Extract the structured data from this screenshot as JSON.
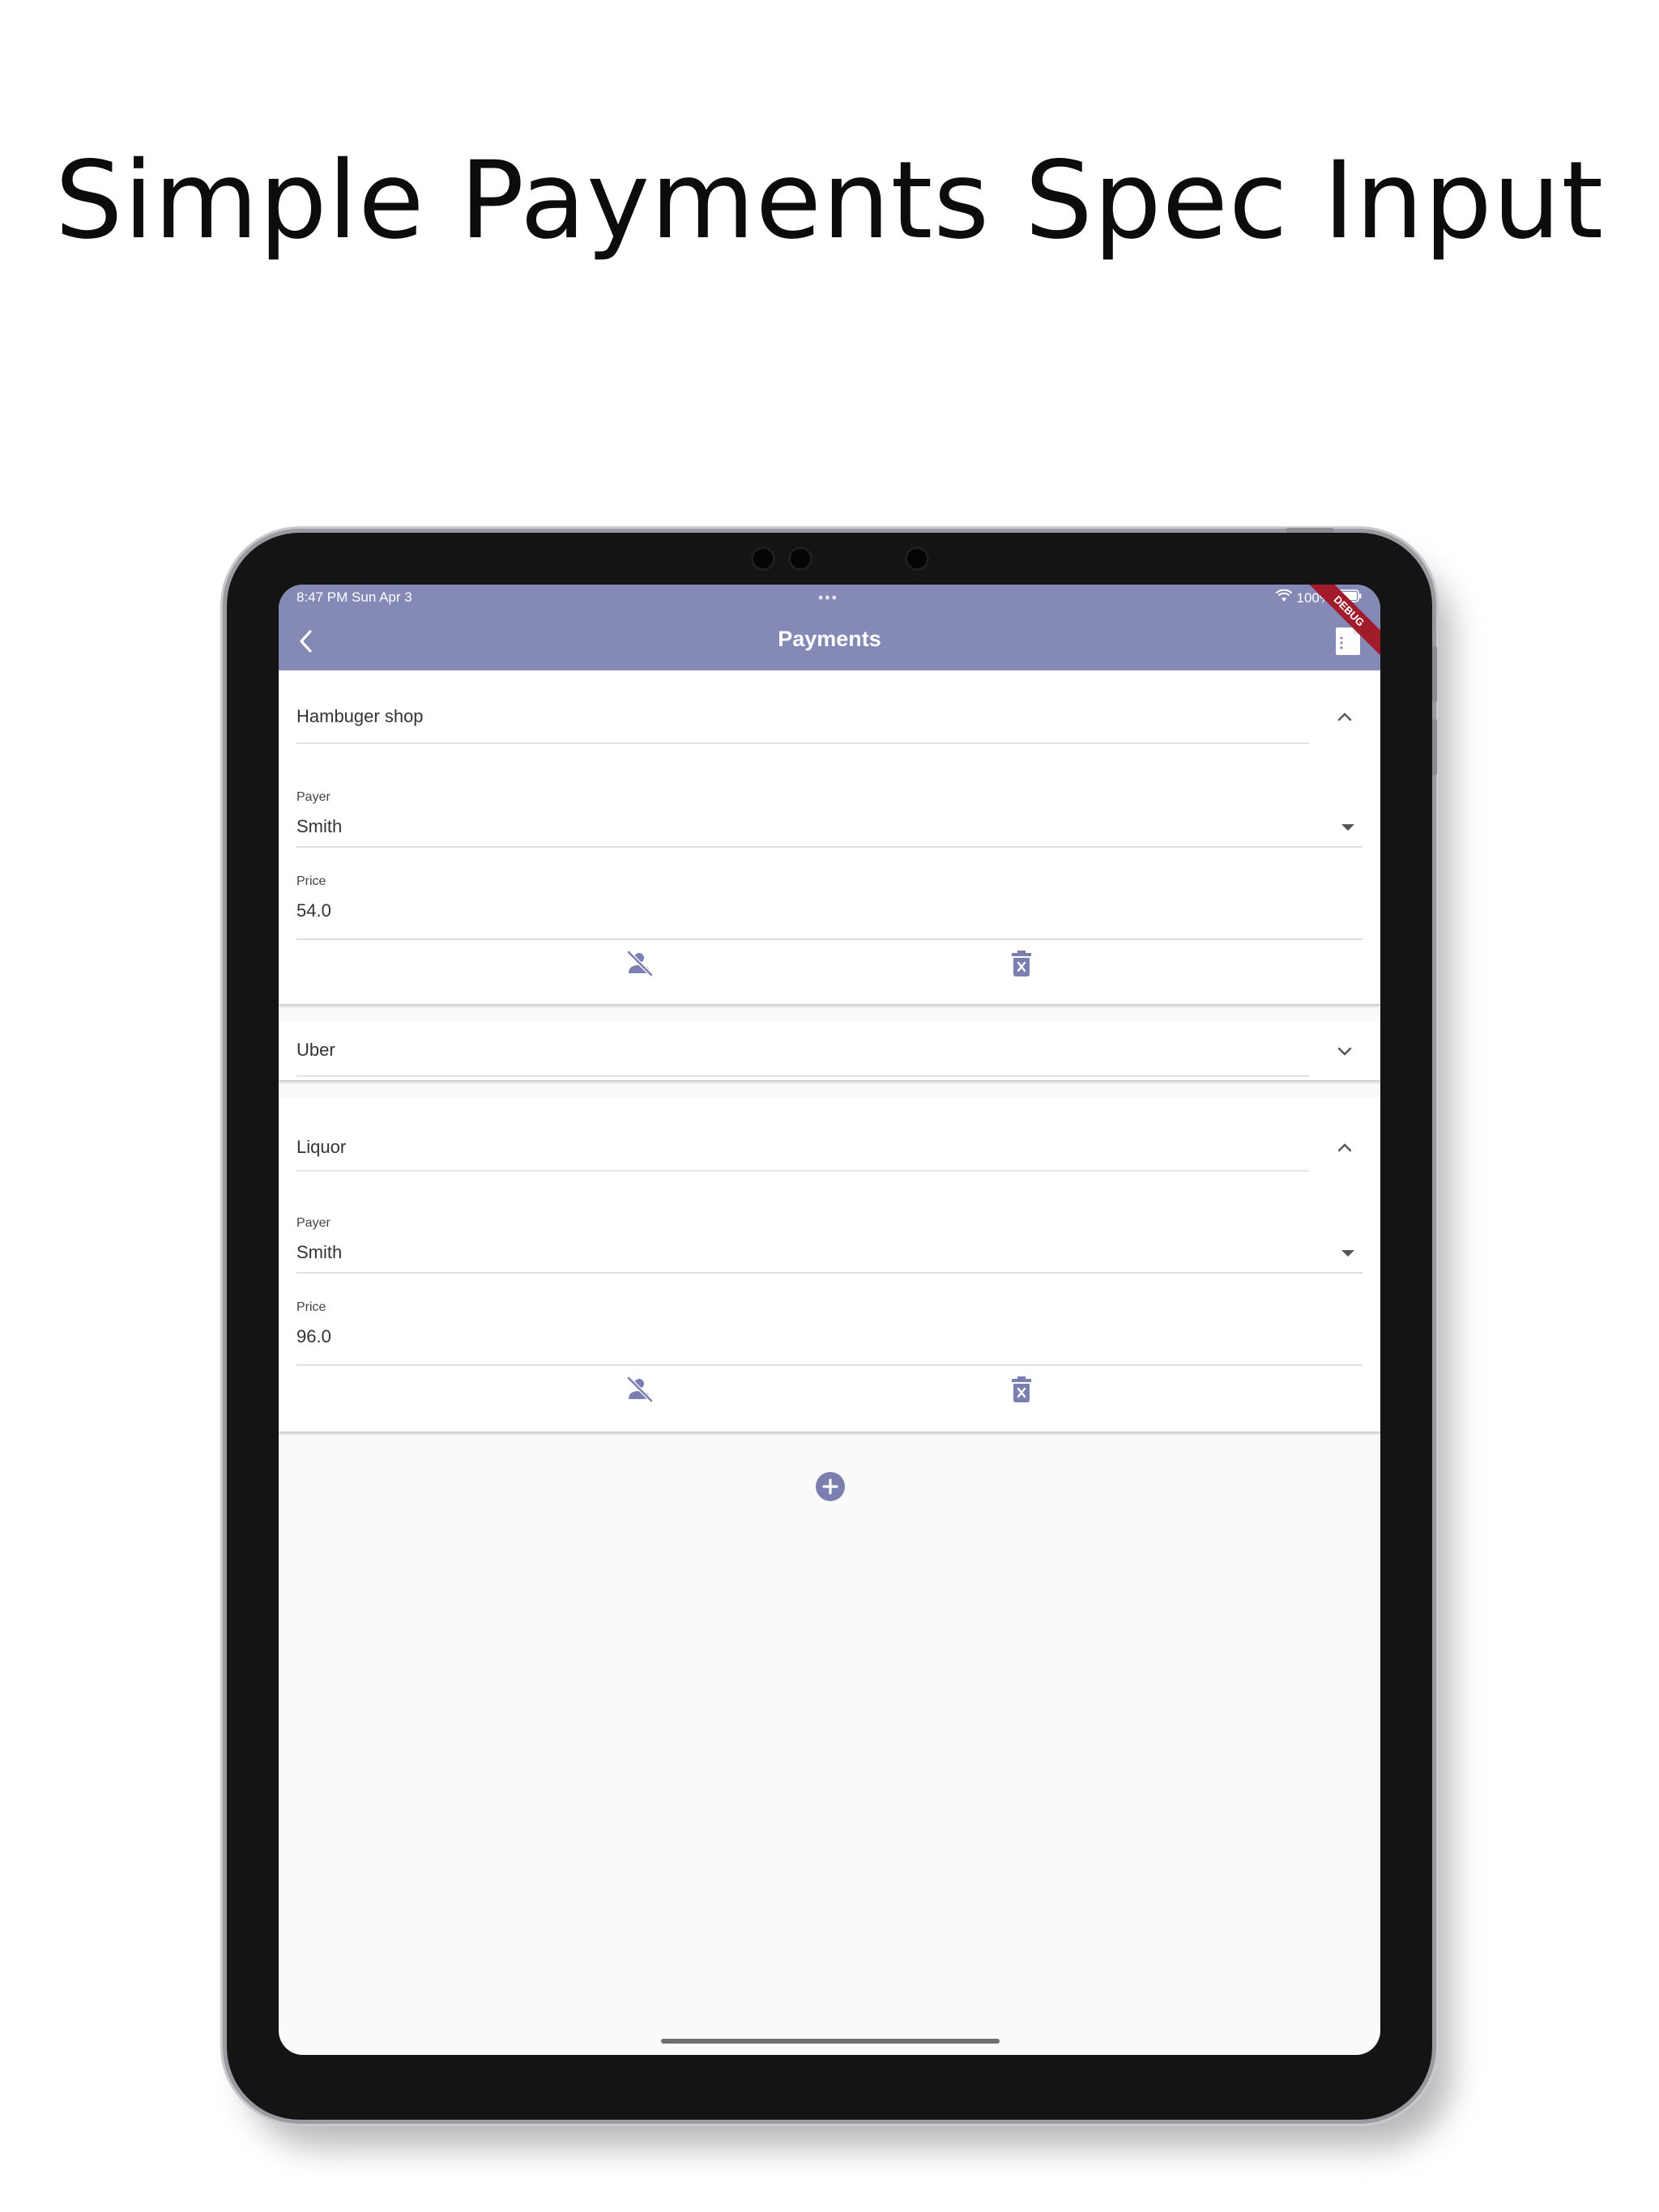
{
  "promo": {
    "title": "Simple Payments Spec Input"
  },
  "status_bar": {
    "time": "8:47 PM   Sun Apr 3",
    "dots": "•••",
    "battery": "100%"
  },
  "appbar": {
    "title": "Payments",
    "debug_label": "DEBUG"
  },
  "panels": [
    {
      "title": "Hambuger shop",
      "expanded": true,
      "payer_label": "Payer",
      "payer": "Smith",
      "price_label": "Price",
      "price": "54.0"
    },
    {
      "title": "Uber",
      "expanded": false
    },
    {
      "title": "Liquor",
      "expanded": true,
      "payer_label": "Payer",
      "payer": "Smith",
      "price_label": "Price",
      "price": "96.0"
    }
  ],
  "colors": {
    "accent": "#8489b5",
    "icon": "#7a7fb0",
    "debug": "#a11b2b"
  },
  "icons": [
    "back-arrow-icon",
    "document-icon",
    "chevron-up-icon",
    "chevron-down-icon",
    "person-off-icon",
    "delete-forever-icon",
    "add-circle-icon",
    "wifi-icon",
    "battery-icon"
  ]
}
